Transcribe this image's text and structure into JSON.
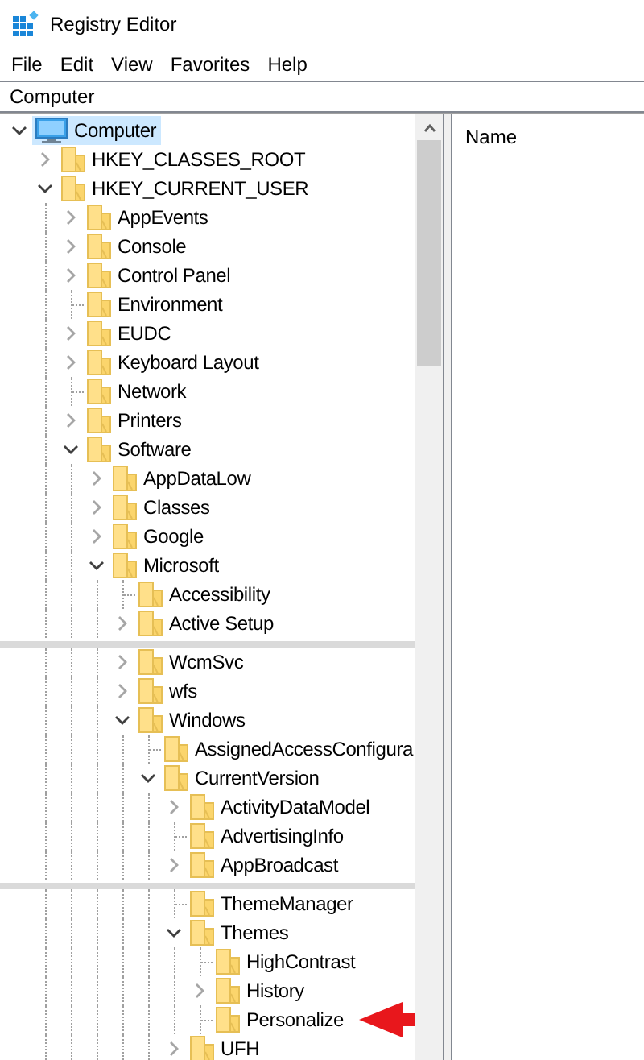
{
  "window": {
    "title": "Registry Editor"
  },
  "menu": [
    "File",
    "Edit",
    "View",
    "Favorites",
    "Help"
  ],
  "address_bar": {
    "value": "Computer"
  },
  "tree": [
    {
      "label": "Computer",
      "kind": "computer",
      "expandable": true,
      "expanded": true,
      "selected": true,
      "children": [
        {
          "label": "HKEY_CLASSES_ROOT",
          "kind": "folder",
          "expandable": true,
          "expanded": false,
          "selected": false
        },
        {
          "label": "HKEY_CURRENT_USER",
          "kind": "folder",
          "expandable": true,
          "expanded": true,
          "selected": false,
          "children": [
            {
              "label": "AppEvents",
              "kind": "folder",
              "expandable": true,
              "expanded": false,
              "selected": false
            },
            {
              "label": "Console",
              "kind": "folder",
              "expandable": true,
              "expanded": false,
              "selected": false
            },
            {
              "label": "Control Panel",
              "kind": "folder",
              "expandable": true,
              "expanded": false,
              "selected": false
            },
            {
              "label": "Environment",
              "kind": "folder",
              "expandable": false,
              "selected": false
            },
            {
              "label": "EUDC",
              "kind": "folder",
              "expandable": true,
              "expanded": false,
              "selected": false
            },
            {
              "label": "Keyboard Layout",
              "kind": "folder",
              "expandable": true,
              "expanded": false,
              "selected": false
            },
            {
              "label": "Network",
              "kind": "folder",
              "expandable": false,
              "selected": false
            },
            {
              "label": "Printers",
              "kind": "folder",
              "expandable": true,
              "expanded": false,
              "selected": false
            },
            {
              "label": "Software",
              "kind": "folder",
              "expandable": true,
              "expanded": true,
              "selected": false,
              "children": [
                {
                  "label": "AppDataLow",
                  "kind": "folder",
                  "expandable": true,
                  "expanded": false,
                  "selected": false
                },
                {
                  "label": "Classes",
                  "kind": "folder",
                  "expandable": true,
                  "expanded": false,
                  "selected": false
                },
                {
                  "label": "Google",
                  "kind": "folder",
                  "expandable": true,
                  "expanded": false,
                  "selected": false
                },
                {
                  "label": "Microsoft",
                  "kind": "folder",
                  "expandable": true,
                  "expanded": true,
                  "selected": false,
                  "children": [
                    {
                      "label": "Accessibility",
                      "kind": "folder",
                      "expandable": false,
                      "selected": false
                    },
                    {
                      "label": "Active Setup",
                      "kind": "folder",
                      "expandable": true,
                      "expanded": false,
                      "selected": false
                    },
                    {
                      "label": "WcmSvc",
                      "kind": "folder",
                      "expandable": true,
                      "expanded": false,
                      "selected": false,
                      "gap_before": true
                    },
                    {
                      "label": "wfs",
                      "kind": "folder",
                      "expandable": true,
                      "expanded": false,
                      "selected": false
                    },
                    {
                      "label": "Windows",
                      "kind": "folder",
                      "expandable": true,
                      "expanded": true,
                      "selected": false,
                      "children": [
                        {
                          "label": "AssignedAccessConfigura",
                          "kind": "folder",
                          "expandable": false,
                          "selected": false
                        },
                        {
                          "label": "CurrentVersion",
                          "kind": "folder",
                          "expandable": true,
                          "expanded": true,
                          "selected": false,
                          "children": [
                            {
                              "label": "ActivityDataModel",
                              "kind": "folder",
                              "expandable": true,
                              "expanded": false,
                              "selected": false
                            },
                            {
                              "label": "AdvertisingInfo",
                              "kind": "folder",
                              "expandable": false,
                              "selected": false
                            },
                            {
                              "label": "AppBroadcast",
                              "kind": "folder",
                              "expandable": true,
                              "expanded": false,
                              "selected": false
                            },
                            {
                              "label": "ThemeManager",
                              "kind": "folder",
                              "expandable": false,
                              "selected": false,
                              "gap_before": true
                            },
                            {
                              "label": "Themes",
                              "kind": "folder",
                              "expandable": true,
                              "expanded": true,
                              "selected": false,
                              "children": [
                                {
                                  "label": "HighContrast",
                                  "kind": "folder",
                                  "expandable": false,
                                  "selected": false
                                },
                                {
                                  "label": "History",
                                  "kind": "folder",
                                  "expandable": true,
                                  "expanded": false,
                                  "selected": false
                                },
                                {
                                  "label": "Personalize",
                                  "kind": "folder",
                                  "expandable": false,
                                  "selected": false,
                                  "pointed_at": true
                                }
                              ]
                            },
                            {
                              "label": "UFH",
                              "kind": "folder",
                              "expandable": true,
                              "expanded": false,
                              "selected": false
                            }
                          ]
                        }
                      ]
                    }
                  ]
                }
              ]
            }
          ]
        }
      ]
    }
  ],
  "list_pane": {
    "columns": [
      "Name"
    ]
  }
}
